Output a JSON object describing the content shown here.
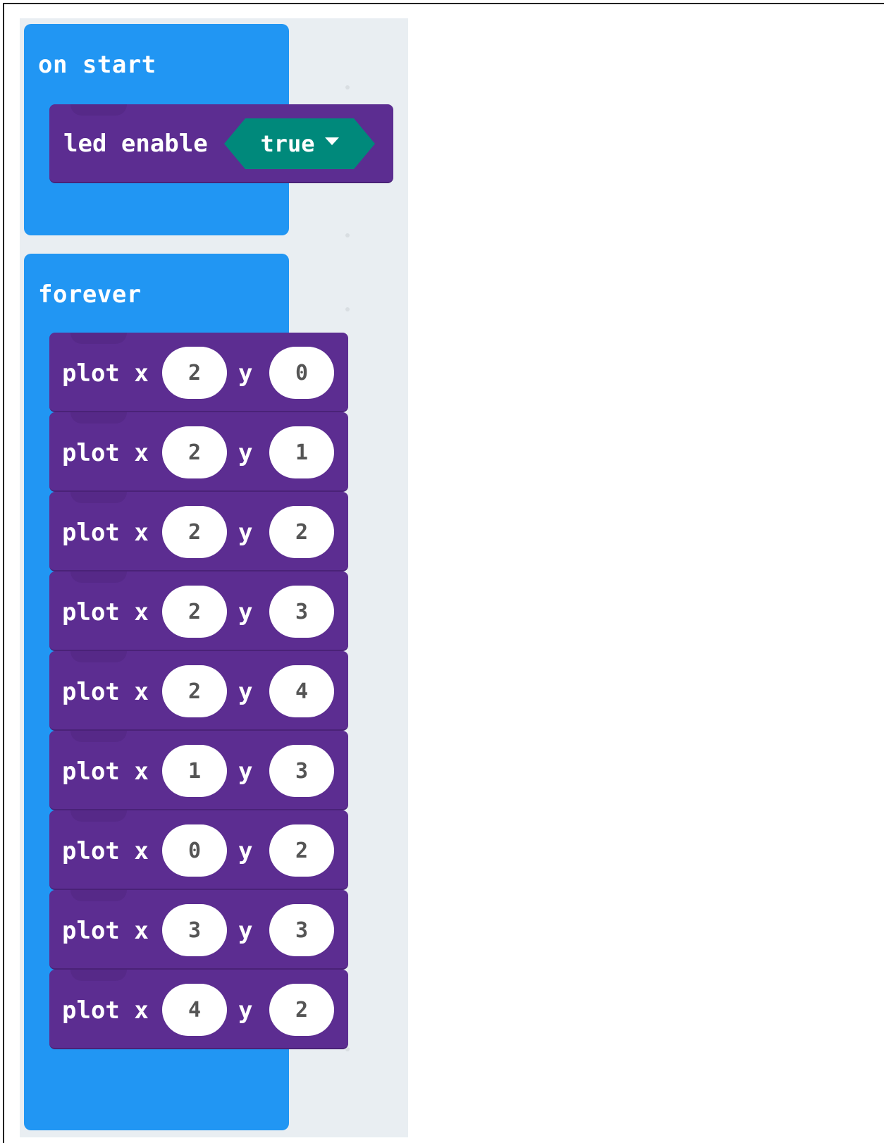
{
  "on_start": {
    "label": "on start",
    "block": {
      "label": "led enable",
      "dropdown_value": "true"
    }
  },
  "forever": {
    "label": "forever",
    "plot_label": "plot x",
    "y_label": "y",
    "plots": [
      {
        "x": "2",
        "y": "0"
      },
      {
        "x": "2",
        "y": "1"
      },
      {
        "x": "2",
        "y": "2"
      },
      {
        "x": "2",
        "y": "3"
      },
      {
        "x": "2",
        "y": "4"
      },
      {
        "x": "1",
        "y": "3"
      },
      {
        "x": "0",
        "y": "2"
      },
      {
        "x": "3",
        "y": "3"
      },
      {
        "x": "4",
        "y": "2"
      }
    ]
  },
  "colors": {
    "event_block": "#2196f3",
    "led_block": "#5c2d91",
    "boolean_dropdown": "#00897b",
    "workspace": "#e9eef2"
  }
}
